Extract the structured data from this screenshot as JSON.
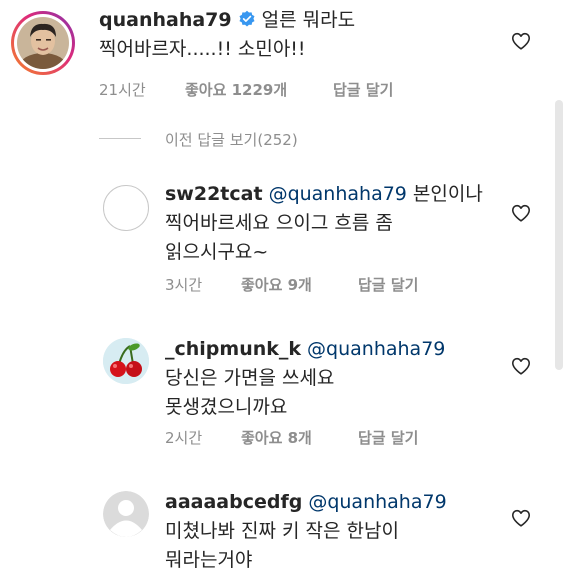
{
  "comments": [
    {
      "username": "quanhaha79",
      "verified": true,
      "text_line1": "얼른 뭐라도",
      "text_line2": "찍어바르자.....!! 소민아!!",
      "time": "21시간",
      "likes": "좋아요 1229개",
      "reply": "답글 달기"
    },
    {
      "username": "sw22tcat",
      "mention": "@quanhaha79",
      "text_line1": "본인이나",
      "text_line2": "찍어바르세요 으이그 흐름 좀",
      "text_line3": "읽으시구요~",
      "time": "3시간",
      "likes": "좋아요 9개",
      "reply": "답글 달기"
    },
    {
      "username": "_chipmunk_k",
      "mention": "@quanhaha79",
      "text_line1": "당신은 가면을 쓰세요",
      "text_line2": "못생겼으니까요",
      "time": "2시간",
      "likes": "좋아요 8개",
      "reply": "답글 달기"
    },
    {
      "username": "aaaaabcedfg",
      "mention": "@quanhaha79",
      "text_line1": "미쳤나봐 진짜 키 작은 한남이",
      "text_line2": "뭐라는거야"
    }
  ],
  "view_previous": "이전 답글 보기(252)",
  "colors": {
    "verified": "#3897f0",
    "ring_start": "#f58529",
    "ring_end": "#dd2a7b",
    "mention": "#00376b"
  },
  "icons": [
    "verified-badge-icon",
    "heart-icon",
    "cherry-icon",
    "default-avatar-icon"
  ]
}
